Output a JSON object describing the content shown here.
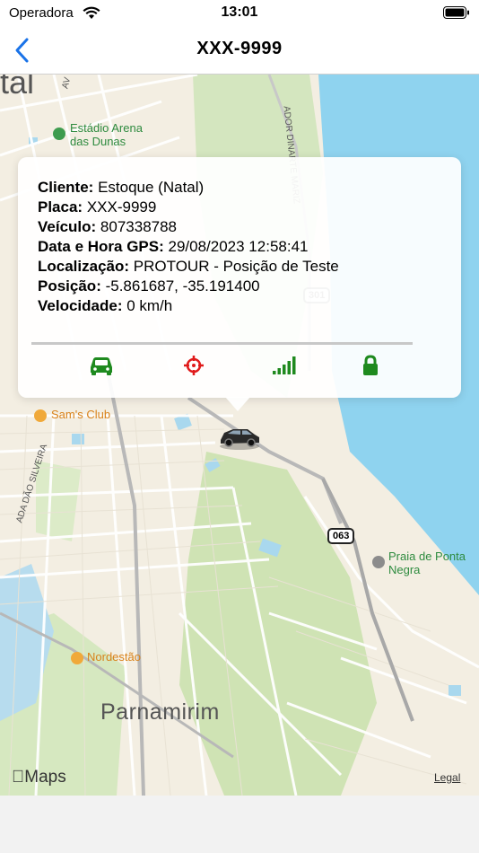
{
  "status_bar": {
    "carrier": "Operadora",
    "time": "13:01"
  },
  "nav": {
    "title": "XXX-9999",
    "back_icon": "chevron-left-icon"
  },
  "info": {
    "cliente_label": "Cliente:",
    "cliente_value": "Estoque (Natal)",
    "placa_label": "Placa:",
    "placa_value": "XXX-9999",
    "veiculo_label": "Veículo:",
    "veiculo_value": "807338788",
    "datahora_label": "Data e Hora GPS:",
    "datahora_value": "29/08/2023 12:58:41",
    "localizacao_label": "Localização:",
    "localizacao_value": "PROTOUR - Posição de Teste",
    "posicao_label": "Posição:",
    "posicao_value": "-5.861687, -35.191400",
    "velocidade_label": "Velocidade:",
    "velocidade_value": "0 km/h"
  },
  "actions": {
    "car_icon": "car-icon",
    "target_icon": "crosshair-icon",
    "signal_icon": "signal-icon",
    "lock_icon": "lock-icon",
    "green": "#1f8a1f",
    "red": "#e01b1b"
  },
  "map": {
    "partial_city": "tal",
    "street_top": "AV",
    "street_right": "ADOR DINARTE MARIZ",
    "stadium": "Estádio Arena das Dunas",
    "sams_club": "Sam's Club",
    "street_left": "ADA DÃO SILVEIRA",
    "route_063": "063",
    "route_301": "301",
    "beach": "Praia de Ponta Negra",
    "nordestao": "Nordestão",
    "city": "Parnamirim",
    "maps_brand": "Maps",
    "legal": "Legal",
    "water_color": "#8fd3ef"
  }
}
